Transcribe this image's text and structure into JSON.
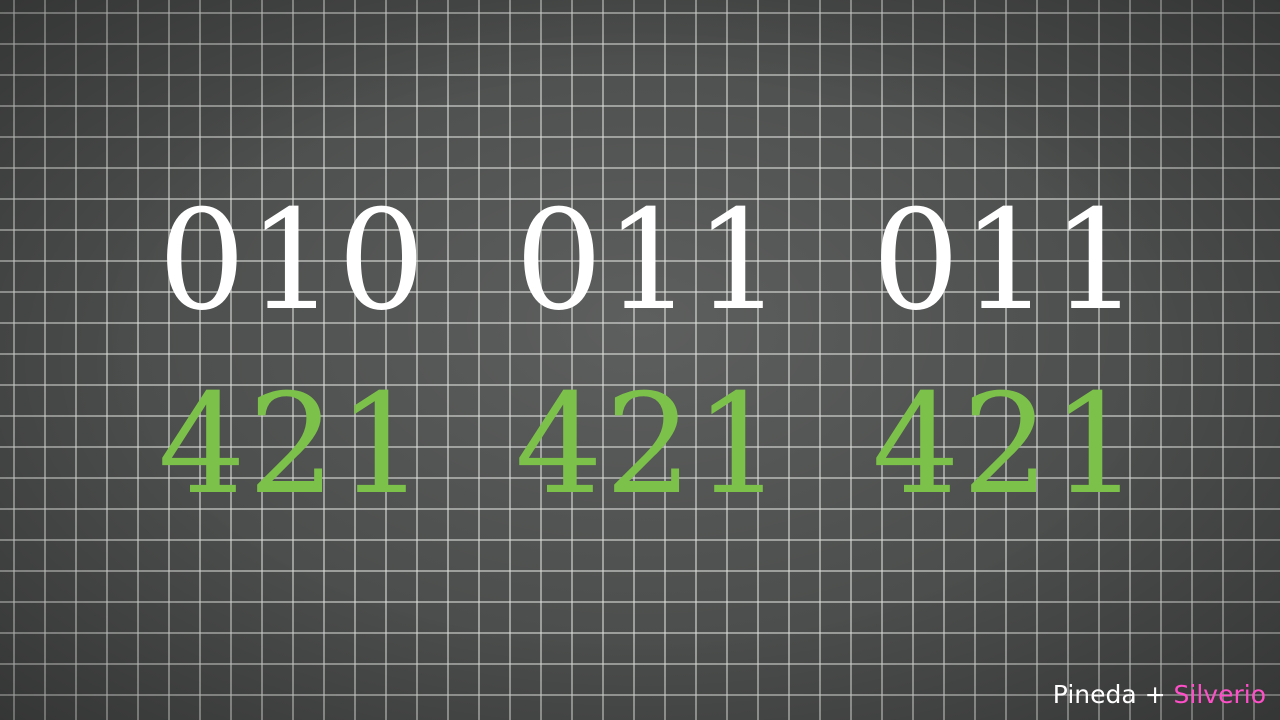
{
  "board": {
    "binary_groups": [
      "010",
      "011",
      "011"
    ],
    "weight_groups": [
      "421",
      "421",
      "421"
    ]
  },
  "credit": {
    "first": "Pineda + ",
    "second": "Silverio"
  },
  "colors": {
    "board": "#4b4d4c",
    "grid": "#dcdedc",
    "binary_text": "#ffffff",
    "weight_text": "#7cc24a",
    "credit_accent": "#ff4fc8"
  }
}
